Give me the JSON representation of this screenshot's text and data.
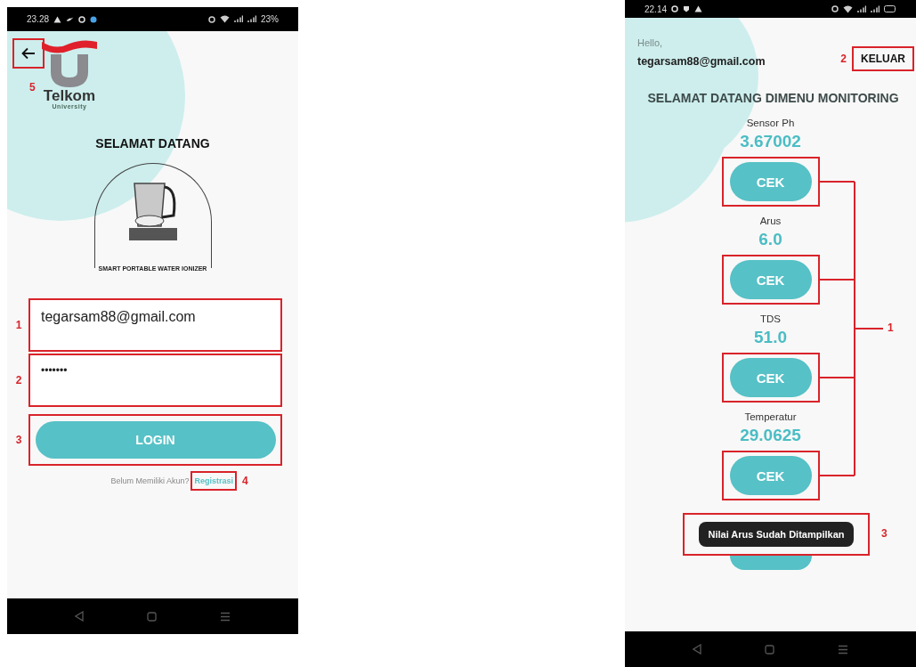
{
  "login_screen": {
    "status_bar": {
      "time": "23.28",
      "battery": "23%"
    },
    "back_button": {
      "callout": "5"
    },
    "logo": {
      "name": "Telkom",
      "subtitle": "University"
    },
    "title": "SELAMAT DATANG",
    "product_caption": "SMART PORTABLE WATER IONIZER",
    "email_field": {
      "value": "tegarsam88@gmail.com",
      "callout": "1"
    },
    "password_field": {
      "value": "•••••••",
      "callout": "2"
    },
    "login_button": {
      "label": "LOGIN",
      "callout": "3"
    },
    "register_prompt": {
      "text": "Belum Memiliki Akun?",
      "link": "Registrasi",
      "callout": "4"
    }
  },
  "monitoring_screen": {
    "status_bar": {
      "time": "22.14"
    },
    "greeting": "Hello,",
    "user_email": "tegarsam88@gmail.com",
    "logout_button": {
      "label": "KELUAR",
      "callout": "2"
    },
    "title": "SELAMAT DATANG DIMENU MONITORING",
    "sensors": [
      {
        "label": "Sensor Ph",
        "value": "3.67002",
        "button_label": "CEK"
      },
      {
        "label": "Arus",
        "value": "6.0",
        "button_label": "CEK"
      },
      {
        "label": "TDS",
        "value": "51.0",
        "button_label": "CEK"
      },
      {
        "label": "Temperatur",
        "value": "29.0625",
        "button_label": "CEK"
      }
    ],
    "check_buttons_callout": "1",
    "toast": {
      "text": "Nilai Arus Sudah Ditampilkan",
      "callout": "3"
    }
  }
}
